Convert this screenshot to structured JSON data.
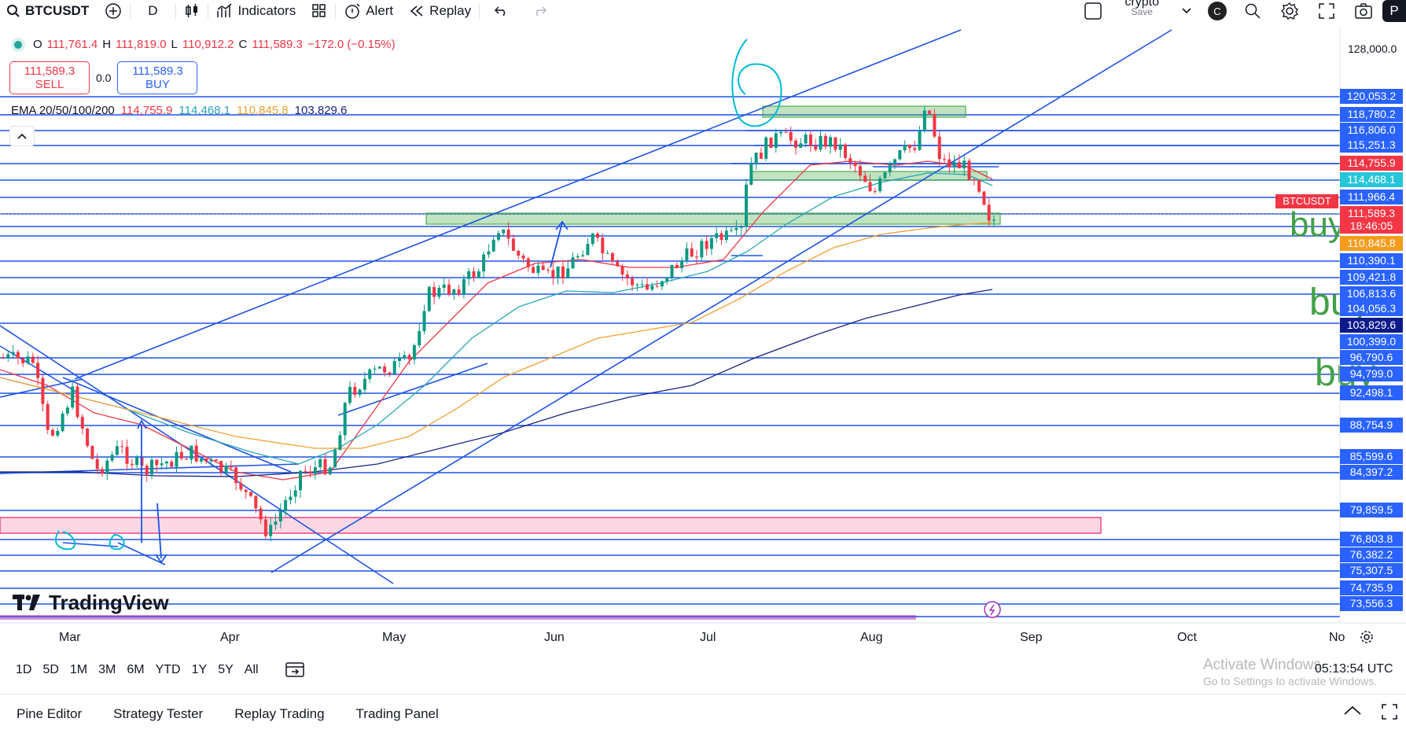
{
  "topbar": {
    "symbol": "BTCUSDT",
    "interval": "D",
    "indicators_label": "Indicators",
    "alert_label": "Alert",
    "replay_label": "Replay",
    "layout_name": "crypto",
    "layout_status": "Save",
    "avatar_letter": "C",
    "publish_partial": "P"
  },
  "legend": {
    "o_label": "O",
    "o_value": "111,761.4",
    "h_label": "H",
    "h_value": "111,819.0",
    "l_label": "L",
    "l_value": "110,912.2",
    "c_label": "C",
    "c_value": "111,589.3",
    "change": "−172.0 (−0.15%)"
  },
  "trade": {
    "sell_price": "111,589.3",
    "sell_label": "SELL",
    "spread": "0.0",
    "buy_price": "111,589.3",
    "buy_label": "BUY"
  },
  "ema": {
    "label": "EMA 20/50/100/200",
    "ema20": "114,755.9",
    "ema50": "114,468.1",
    "ema100": "110,845.8",
    "ema200": "103,829.6",
    "color20": "#f23645",
    "color50": "#26a6b8",
    "color100": "#f0a030",
    "color200": "#1a237e"
  },
  "price_scale": {
    "top_tick": "128,000.0",
    "labels": [
      {
        "text": "120,053.2",
        "bg": "#2962ff"
      },
      {
        "text": "118,780.2",
        "bg": "#2962ff"
      },
      {
        "text": "116,806.0",
        "bg": "#2962ff"
      },
      {
        "text": "115,251.3",
        "bg": "#2962ff"
      },
      {
        "text": "114,755.9",
        "bg": "#f23645"
      },
      {
        "text": "114,468.1",
        "bg": "#26c6da"
      },
      {
        "text": "111,966.4",
        "bg": "#2962ff"
      },
      {
        "text": "111,589.3",
        "bg": "#f23645"
      },
      {
        "text": "18:46:05",
        "bg": "#f23645"
      },
      {
        "text": "110,845.8",
        "bg": "#f59c1a"
      },
      {
        "text": "110,390.1",
        "bg": "#2962ff"
      },
      {
        "text": "109,421.8",
        "bg": "#2962ff"
      },
      {
        "text": "106,813.6",
        "bg": "#2962ff"
      },
      {
        "text": "104,056.3",
        "bg": "#2962ff"
      },
      {
        "text": "103,829.6",
        "bg": "#0d1a8a"
      },
      {
        "text": "100,399.0",
        "bg": "#2962ff"
      },
      {
        "text": "96,790.6",
        "bg": "#2962ff"
      },
      {
        "text": "94,799.0",
        "bg": "#2962ff"
      },
      {
        "text": "92,498.1",
        "bg": "#2962ff"
      },
      {
        "text": "88,754.9",
        "bg": "#2962ff"
      },
      {
        "text": "85,599.6",
        "bg": "#2962ff"
      },
      {
        "text": "84,397.2",
        "bg": "#2962ff"
      },
      {
        "text": "79,859.5",
        "bg": "#2962ff"
      },
      {
        "text": "76,803.8",
        "bg": "#2962ff"
      },
      {
        "text": "76,382.2",
        "bg": "#2962ff"
      },
      {
        "text": "75,307.5",
        "bg": "#2962ff"
      },
      {
        "text": "74,735.9",
        "bg": "#2962ff"
      },
      {
        "text": "73,556.3",
        "bg": "#2962ff"
      }
    ],
    "symbol_tag": "BTCUSDT"
  },
  "annotations": {
    "buy_text": "buy"
  },
  "time_axis": {
    "labels": [
      "Mar",
      "Apr",
      "May",
      "Jun",
      "Jul",
      "Aug",
      "Sep",
      "Oct",
      "No"
    ]
  },
  "watermark": "TradingView",
  "range_buttons": [
    "1D",
    "5D",
    "1M",
    "3M",
    "6M",
    "YTD",
    "1Y",
    "5Y",
    "All"
  ],
  "clock": "05:13:54 UTC",
  "activate": {
    "title": "Activate Windows",
    "subtitle": "Go to Settings to activate Windows."
  },
  "footer": {
    "tabs": [
      "Pine Editor",
      "Strategy Tester",
      "Replay Trading",
      "Trading Panel"
    ]
  }
}
